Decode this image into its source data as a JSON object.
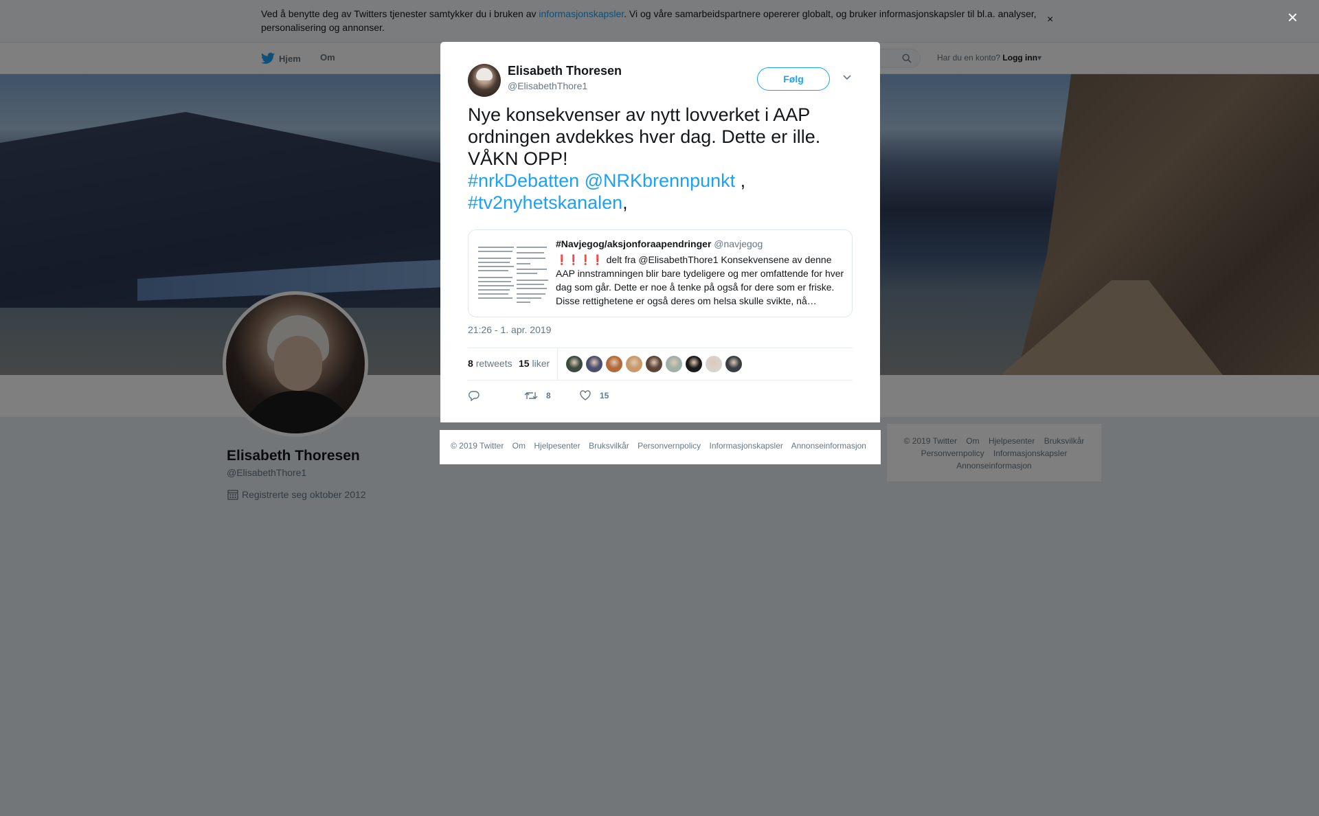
{
  "cookie_banner": {
    "text_before": "Ved å benytte deg av Twitters tjenester samtykker du i bruken av ",
    "link": "informasjonskapsler",
    "text_after": ". Vi og våre samarbeidspartnere opererer globalt, og bruker informasjonskapsler til bl.a. analyser, personalisering og annonser.",
    "close": "×"
  },
  "nav": {
    "home": "Hjem",
    "about": "Om",
    "login_prompt": "Har du en konto?",
    "login": "Logg inn"
  },
  "profile": {
    "name": "Elisabeth Thoresen",
    "handle": "@ElisabethThore1",
    "joined": "Registrerte seg oktober 2012"
  },
  "right_footer": {
    "links": [
      "© 2019 Twitter",
      "Om",
      "Hjelpesenter",
      "Bruksvilkår",
      "Personvernpolicy",
      "Informasjonskapsler",
      "Annonseinformasjon"
    ]
  },
  "overlay": {
    "close": "×"
  },
  "tweet": {
    "author_name": "Elisabeth Thoresen",
    "author_handle": "@ElisabethThore1",
    "follow_label": "Følg",
    "text": "Nye konsekvenser av nytt lovverket i AAP ordningen avdekkes hver dag. Dette er ille. VÅKN OPP!",
    "hashtag1": "#nrkDebatten",
    "mention": "@NRKbrennpunkt",
    "comma1": " ,",
    "hashtag2": "#tv2nyhetskanalen",
    "comma2": ",",
    "quote": {
      "name": "#Navjegog/aksjonforaapendringer",
      "handle": "@navjegog",
      "emoji": "❗❗❗❗",
      "body": "delt fra @ElisabethThore1  Konsekvensene av denne AAP innstramningen blir bare tydeligere og mer omfattende for hver dag som går. Dette er noe å tenke på også for dere som er friske. Disse rettighetene er også deres om helsa skulle svikte, nå…"
    },
    "time": "21:26 - 1. apr. 2019",
    "retweets_count": "8",
    "retweets_label": "retweets",
    "likes_count": "15",
    "likes_label": "liker",
    "action_retweets": "8",
    "action_likes": "15"
  },
  "modal_footer": {
    "links": [
      "© 2019 Twitter",
      "Om",
      "Hjelpesenter",
      "Bruksvilkår",
      "Personvernpolicy",
      "Informasjonskapsler",
      "Annonseinformasjon"
    ]
  },
  "colors": {
    "accent": "#1da1f2",
    "like_red": "#e0245e",
    "overlay": "rgba(0,0,0,0.5)"
  },
  "liker_avatar_colors": [
    "#3b4a3f",
    "#4b4f6e",
    "#b36a3a",
    "#c89a6a",
    "#5a4536",
    "#9fb0a5",
    "#1a1a1a",
    "#d7d2ca",
    "#3a3e44"
  ]
}
